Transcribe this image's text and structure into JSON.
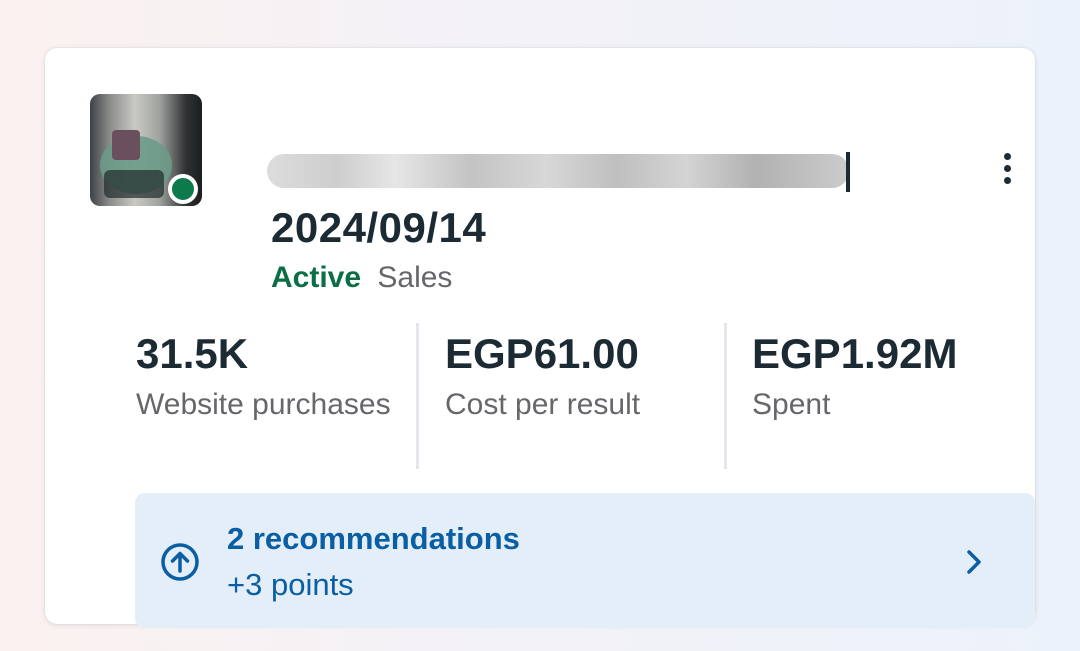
{
  "campaign": {
    "title_line2": "2024/09/14",
    "status": "Active",
    "objective": "Sales"
  },
  "metrics": [
    {
      "value": "31.5K",
      "label": "Website purchases"
    },
    {
      "value": "EGP61.00",
      "label": "Cost per result"
    },
    {
      "value": "EGP1.92M",
      "label": "Spent"
    }
  ],
  "recommendations": {
    "title": "2 recommendations",
    "points": "+3 points"
  },
  "icons": {
    "more": "more-vertical-icon",
    "recommendation": "arrow-up-circle-icon",
    "chevron": "chevron-right-icon"
  },
  "colors": {
    "active": "#0b6e44",
    "link": "#0a5ea3",
    "reco_bg": "#e3eef8"
  }
}
